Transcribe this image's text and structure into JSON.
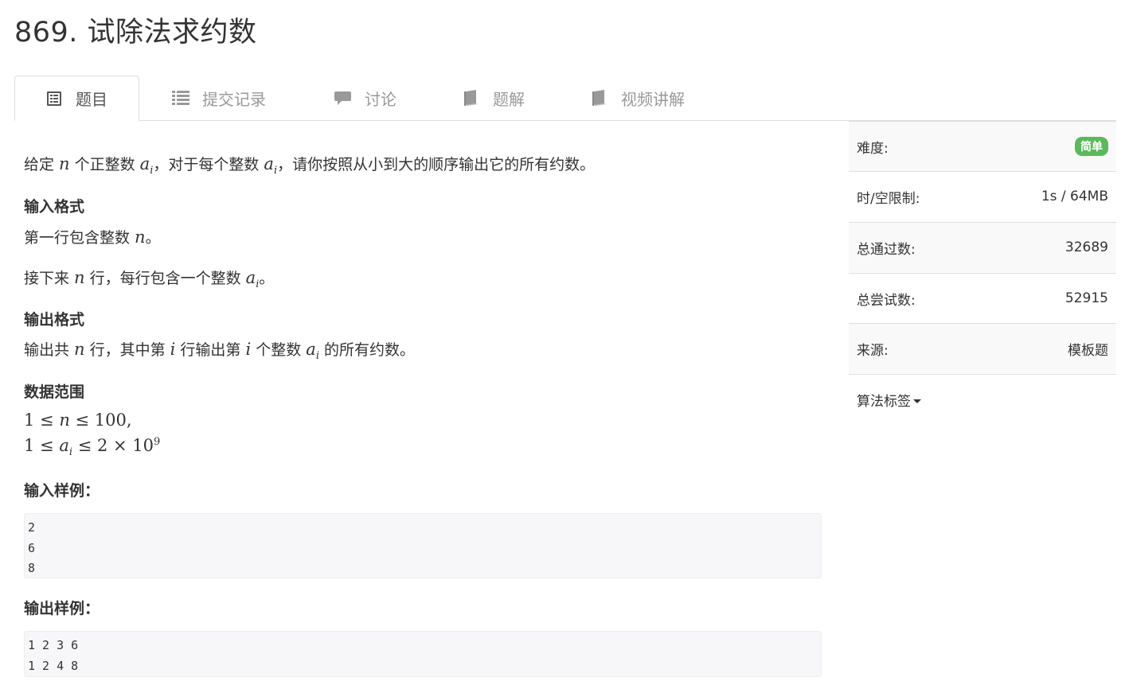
{
  "title": "869. 试除法求约数",
  "tabs": [
    {
      "label": "题目",
      "icon": "list-alt-icon",
      "active": true
    },
    {
      "label": "提交记录",
      "icon": "list-icon"
    },
    {
      "label": "讨论",
      "icon": "comment-icon"
    },
    {
      "label": "题解",
      "icon": "book-icon"
    },
    {
      "label": "视频讲解",
      "icon": "book-icon"
    }
  ],
  "problem": {
    "desc": {
      "t1": "给定 ",
      "v1": "n",
      "t2": " 个正整数 ",
      "v2": "a",
      "s2": "i",
      "t3": "，对于每个整数 ",
      "v3": "a",
      "s3": "i",
      "t4": "，请你按照从小到大的顺序输出它的所有约数。"
    },
    "input_heading": "输入格式",
    "input_line1": {
      "t1": "第一行包含整数 ",
      "v1": "n",
      "t2": "。"
    },
    "input_line2": {
      "t1": "接下来 ",
      "v1": "n",
      "t2": " 行，每行包含一个整数 ",
      "v2": "a",
      "s2": "i",
      "t3": "。"
    },
    "output_heading": "输出格式",
    "output_line": {
      "t1": "输出共 ",
      "v1": "n",
      "t2": " 行，其中第 ",
      "v2": "i",
      "t3": " 行输出第 ",
      "v3": "i",
      "t4": " 个整数 ",
      "v4": "a",
      "s4": "i",
      "t5": " 的所有约数。"
    },
    "range_heading": "数据范围",
    "range1": {
      "a": "1 ≤ ",
      "v": "n",
      "b": " ≤ 100,"
    },
    "range2": {
      "a": "1 ≤ ",
      "v": "a",
      "s": "i",
      "b": " ≤ 2 × 10",
      "sup": "9"
    },
    "sample_in_heading": "输入样例：",
    "sample_in": [
      "2",
      "6",
      "8"
    ],
    "sample_out_heading": "输出样例：",
    "sample_out": [
      "1 2 3 6",
      "1 2 4 8"
    ]
  },
  "sidebar": {
    "difficulty_label": "难度:",
    "difficulty_value": "简单",
    "difficulty_color": "#5cb85c",
    "limit_label": "时/空限制:",
    "limit_value": "1s / 64MB",
    "passed_label": "总通过数:",
    "passed_value": "32689",
    "tried_label": "总尝试数:",
    "tried_value": "52915",
    "source_label": "来源:",
    "source_value": "模板题",
    "tags_label": "算法标签"
  }
}
